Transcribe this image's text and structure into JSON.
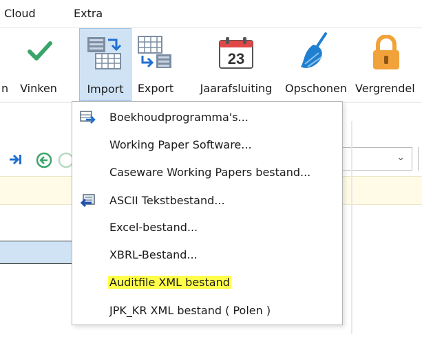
{
  "menubar": {
    "items": [
      "Cloud",
      "Extra"
    ]
  },
  "ribbon": {
    "buttons": [
      {
        "label": "n",
        "icon": "partial-icon"
      },
      {
        "label": "Vinken",
        "icon": "checkmark-icon"
      },
      {
        "label": "Import",
        "icon": "import-grid-icon"
      },
      {
        "label": "Export",
        "icon": "export-grid-icon"
      },
      {
        "label": "Jaarafsluiting",
        "icon": "calendar-icon",
        "icon_text": "23"
      },
      {
        "label": "Opschonen",
        "icon": "broom-icon"
      },
      {
        "label": "Vergrendel",
        "icon": "padlock-icon"
      }
    ]
  },
  "toolbar": {
    "combo_chevron": "⌄"
  },
  "dropdown": {
    "items": [
      {
        "label": "Boekhoudprogramma's...",
        "icon": "import-db-icon"
      },
      {
        "label": "Working Paper Software..."
      },
      {
        "label": "Caseware Working Papers bestand..."
      },
      {
        "label": "ASCII Tekstbestand...",
        "icon": "ascii-import-icon"
      },
      {
        "label": "Excel-bestand..."
      },
      {
        "label": "XBRL-Bestand..."
      },
      {
        "label": "Auditfile XML bestand",
        "highlighted": true
      },
      {
        "label": "JPK_KR XML bestand ( Polen )"
      }
    ]
  },
  "colors": {
    "accent_green": "#3aa56a",
    "active_blue": "#cfe3f5",
    "highlight_yellow": "#ffff4a",
    "calendar_red": "#e04848",
    "broom_blue": "#1f7fd1",
    "lock_orange": "#f2a23a"
  }
}
